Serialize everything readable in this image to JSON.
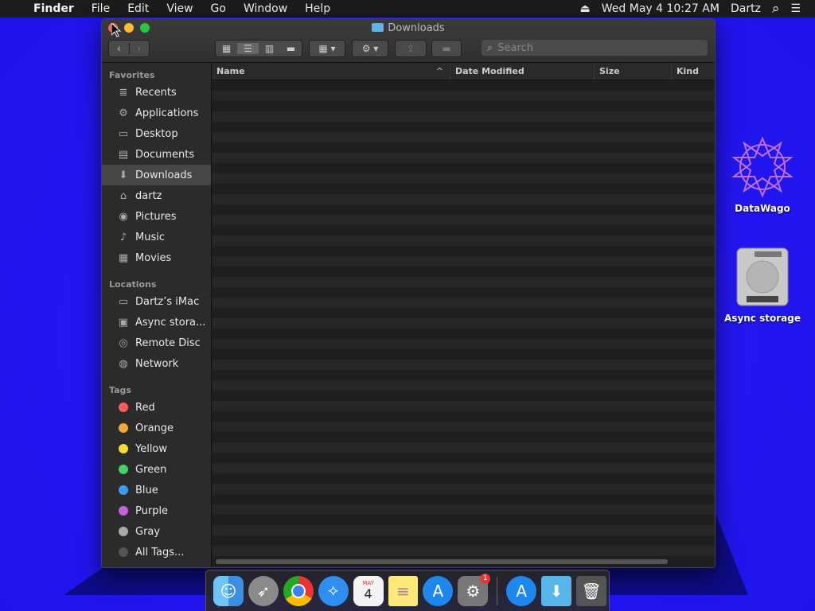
{
  "menubar": {
    "apple": "",
    "app": "Finder",
    "items": [
      "File",
      "Edit",
      "View",
      "Go",
      "Window",
      "Help"
    ],
    "eject": "⏏",
    "datetime": "Wed May 4  10:27 AM",
    "user": "Dartz",
    "search_icon": "⌕",
    "list_icon": "☰"
  },
  "window": {
    "title": "Downloads",
    "search_placeholder": "Search"
  },
  "sidebar": {
    "favorites_label": "Favorites",
    "favorites": [
      {
        "label": "Recents",
        "icon": "≣"
      },
      {
        "label": "Applications",
        "icon": "⚙"
      },
      {
        "label": "Desktop",
        "icon": "▭"
      },
      {
        "label": "Documents",
        "icon": "▤"
      },
      {
        "label": "Downloads",
        "icon": "⬇"
      },
      {
        "label": "dartz",
        "icon": "⌂"
      },
      {
        "label": "Pictures",
        "icon": "◉"
      },
      {
        "label": "Music",
        "icon": "♪"
      },
      {
        "label": "Movies",
        "icon": "▦"
      }
    ],
    "locations_label": "Locations",
    "locations": [
      {
        "label": "Dartz’s iMac",
        "icon": "▭"
      },
      {
        "label": "Async stora...",
        "icon": "▣"
      },
      {
        "label": "Remote Disc",
        "icon": "◎"
      },
      {
        "label": "Network",
        "icon": "◍"
      }
    ],
    "tags_label": "Tags",
    "tags": [
      {
        "label": "Red",
        "color": "#ff5b5b"
      },
      {
        "label": "Orange",
        "color": "#f7a533"
      },
      {
        "label": "Yellow",
        "color": "#f4dc2e"
      },
      {
        "label": "Green",
        "color": "#3fd463"
      },
      {
        "label": "Blue",
        "color": "#3c9df5"
      },
      {
        "label": "Purple",
        "color": "#c562e0"
      },
      {
        "label": "Gray",
        "color": "#a8a8a8"
      },
      {
        "label": "All Tags...",
        "color": "#555555"
      }
    ]
  },
  "columns": {
    "name": "Name",
    "date": "Date Modified",
    "size": "Size",
    "kind": "Kind",
    "sort": "^"
  },
  "desktop_icons": [
    {
      "label": "DataWago"
    },
    {
      "label": "Async storage"
    }
  ],
  "dock": {
    "calendar_month": "MAY",
    "calendar_day": "4",
    "badge": "1"
  }
}
